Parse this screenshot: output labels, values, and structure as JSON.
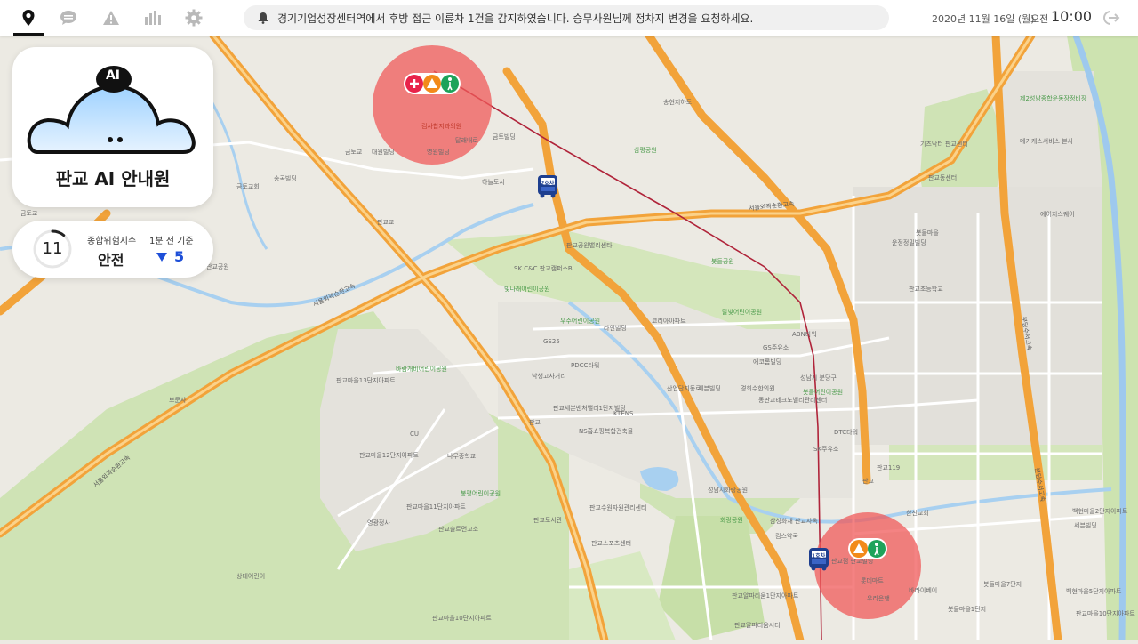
{
  "topbar": {
    "nav": [
      {
        "name": "location",
        "icon": "map-pin-icon",
        "active": true
      },
      {
        "name": "chat",
        "icon": "chat-bubble-icon",
        "active": false
      },
      {
        "name": "warning",
        "icon": "warning-triangle-icon",
        "active": false
      },
      {
        "name": "stats",
        "icon": "bar-chart-icon",
        "active": false
      },
      {
        "name": "settings",
        "icon": "gear-icon",
        "active": false
      }
    ],
    "notification": "경기기업성장센터역에서 후방 접근 이륜차 1건을 감지하였습니다. 승무사원님께 정차지 변경을 요청하세요.",
    "date": "2020년 11월 16일 (월)",
    "ampm": "오전",
    "time": "10:00"
  },
  "ai_card": {
    "badge": "AI",
    "title": "판교 AI 안내원"
  },
  "risk": {
    "score": "11",
    "score_fraction": 0.11,
    "label": "종합위험지수",
    "value": "안전",
    "prev_label": "1분 전 기준",
    "delta": "5",
    "delta_direction": "down"
  },
  "buses": [
    {
      "label": "2호차"
    },
    {
      "label": "1호차"
    }
  ],
  "map": {
    "labels": {
      "l1": "금토교회",
      "l2": "송곡빌딩",
      "l3": "금토교",
      "l4": "영원빌딩",
      "l5": "달래내로",
      "l6": "금토빌딩",
      "l7": "대원빌딩",
      "l8": "하늘도서",
      "l9": "판교교",
      "l10": "금토교",
      "l11": "판교공원",
      "l12": "서울외곽순환고속",
      "l13": "판교공원밸리센타",
      "l14": "SK C&C 판교캠퍼스B",
      "l15": "빛나래어린이공원",
      "l16": "우주어린이공원",
      "l17": "라인빌딩",
      "l18": "GS25",
      "l19": "PDCC타워",
      "l20": "낙생고사거리",
      "l21": "판교세븐밴처밸리1단지빌딩",
      "l22": "KTENS",
      "l23": "NS홈쇼핑복합건축물",
      "l24": "CU",
      "l25": "판교",
      "l26": "판교마을13단지아파트",
      "l27": "바람개비어린이공원",
      "l28": "판교마을12단지아파트",
      "l29": "판교마을11단지아파트",
      "l30": "나무중학교",
      "l31": "봉평어린이공원",
      "l32": "판교솔트면교소",
      "l33": "영광정사",
      "l34": "판교마을10단지아파트",
      "l35": "판교스포츠센터",
      "l36": "판교수원자원관리센터",
      "l37": "판교알파리움1단지아파트",
      "l38": "판교알파리움시티",
      "l39": "상대어린이",
      "l40": "운정정밀빌딩",
      "l41": "송현지하도",
      "l42": "삼평공원",
      "l43": "기즈닥터 판교센터",
      "l44": "판교동센터",
      "l45": "제2성남종합운동장정비장",
      "l46": "메가케스서비스 본사",
      "l47": "에이치스퀘어",
      "l48": "봇들마을",
      "l49": "판교초등학교",
      "l50": "봇들공원",
      "l51": "산업단지동로",
      "l52": "달빛어린이공원",
      "l53": "코리아아파트",
      "l54": "GS주유소",
      "l55": "ABN타워",
      "l56": "에코롬빌딩",
      "l57": "세븐빌딩",
      "l58": "경희수한의원",
      "l59": "동판교테크노밸리관리센터",
      "l60": "봇들어린이공원",
      "l61": "DTC타워",
      "l62": "판교",
      "l63": "화랑공원",
      "l64": "성남시화랑공원",
      "l65": "판교119",
      "l66": "SK주유소",
      "l67": "삼성화재 판교사옥",
      "l68": "킴스약국",
      "l69": "판교점 판교빌딩",
      "l70": "한신교회",
      "l71": "롯데마트",
      "l72": "바라이베이",
      "l73": "우리은행",
      "l74": "봇들마을1단지",
      "l75": "봇들마을7단지",
      "l76": "백현마을2단지아파트",
      "l77": "백현마을5단지아파트",
      "l78": "세븐빌딩",
      "l79": "판교마을10단지아파트",
      "l80": "경부고속도로",
      "l81": "성남시 분당구",
      "l82": "판교도서관",
      "l83": "보문사"
    },
    "roads": {
      "r1": "서울외곽순환고속",
      "r2": "서울외곽순환고속",
      "r3": "서울외곽순환고속",
      "r4": "경부고속도로",
      "r5": "분당수서고속",
      "r6": "분당수서고속"
    }
  },
  "colors": {
    "accent": "#111111",
    "risk_zone": "#f05a5a",
    "highway": "#f2a33a",
    "bus_blue": "#1e3f8f",
    "route": "#b0243a",
    "delta_blue": "#1e4fd8"
  }
}
